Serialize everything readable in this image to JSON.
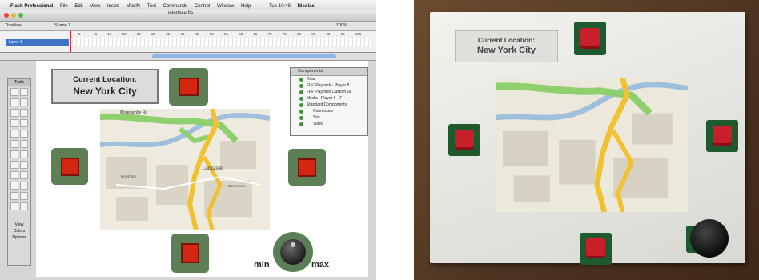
{
  "flash_ui": {
    "menubar": [
      "Flash Professional",
      "File",
      "Edit",
      "View",
      "Insert",
      "Modify",
      "Text",
      "Commands",
      "Control",
      "Window",
      "Help"
    ],
    "clock": "Tue 10:49",
    "user": "Nicolas",
    "document_title": "interface.fla",
    "timeline_tab": "Timeline",
    "scene_label": "Scene 1",
    "zoom": "100%",
    "layer_name": "Layer 1",
    "ruler_numbers": [
      "5",
      "10",
      "15",
      "20",
      "25",
      "30",
      "35",
      "40",
      "45",
      "50",
      "55",
      "60",
      "65",
      "70",
      "75",
      "80",
      "85",
      "90",
      "95",
      "100"
    ],
    "tools_title": "Tools",
    "view_title": "View",
    "colors_title": "Colors",
    "options_title": "Options"
  },
  "location_label": "Current Location:",
  "location_city": "New York City",
  "knob_min": "min",
  "knob_max": "max",
  "map_labels": {
    "town": "Lancaster",
    "road": "Morecambe Rd",
    "place_w": "Heysham",
    "place_e": "Bowerham"
  },
  "components_panel": {
    "title": "Components",
    "items": [
      "Data",
      "FLV Playback - Player 8",
      "FLV Playback Custom UI",
      "Media - Player 6 - 7",
      "Standard Components",
      "Connection",
      "Slot",
      "Video"
    ]
  },
  "colors": {
    "sensor_green": "#5e7e56",
    "button_red": "#d42610",
    "pcb_green": "#1f5a2e"
  }
}
